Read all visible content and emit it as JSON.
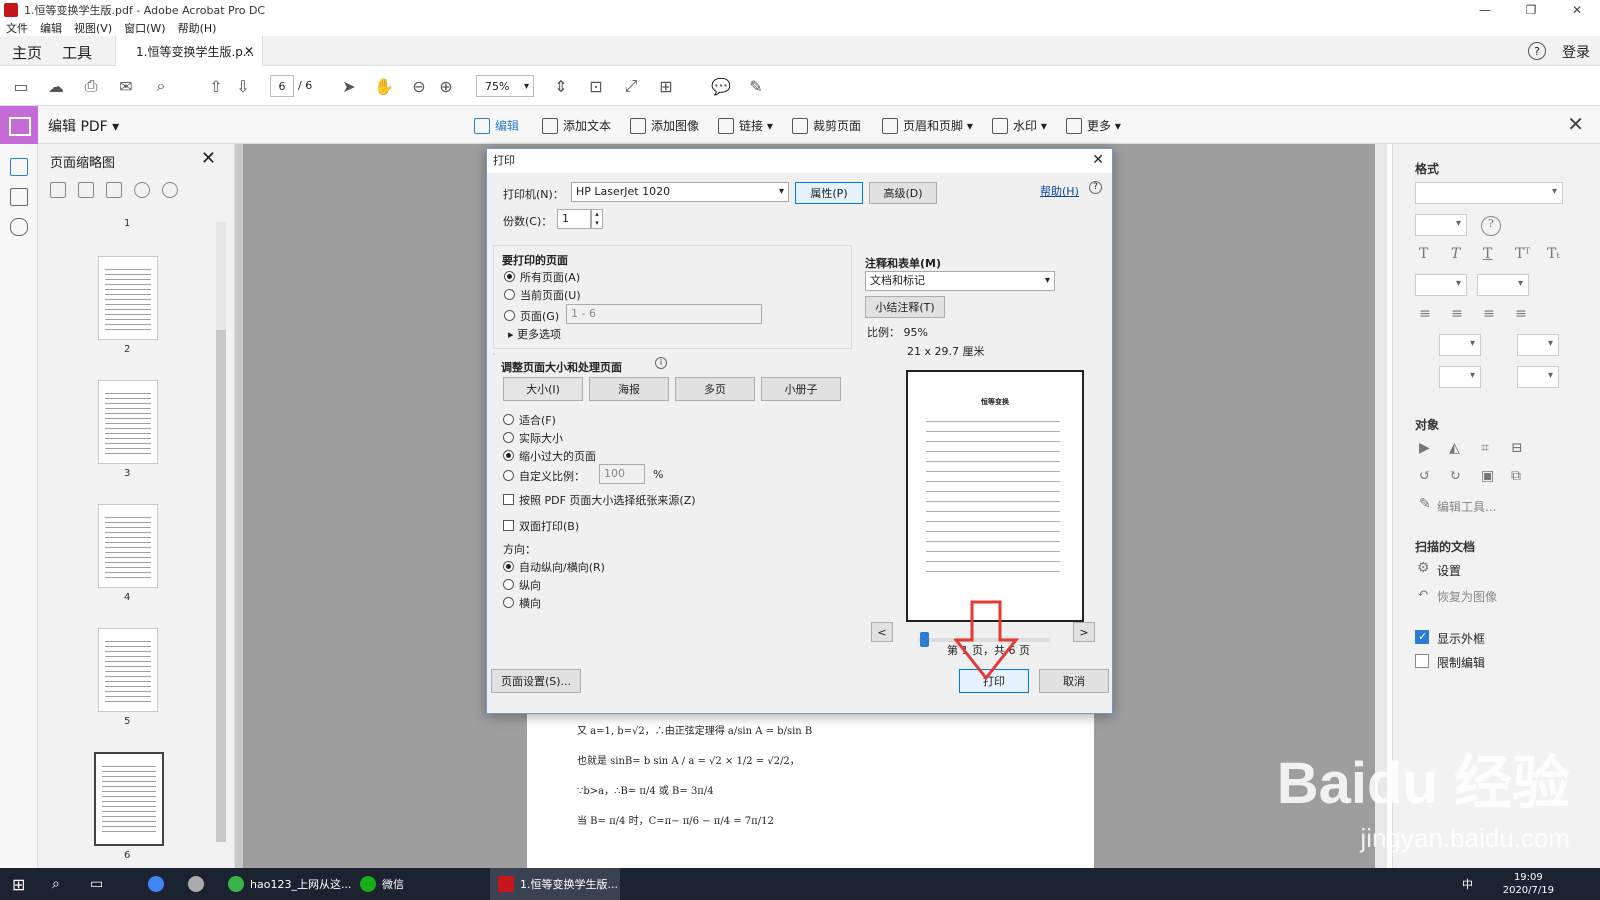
{
  "window": {
    "title": "1.恒等变换学生版.pdf - Adobe Acrobat Pro DC",
    "controls": [
      "—",
      "❐",
      "✕"
    ]
  },
  "menu": [
    "文件",
    "编辑",
    "视图(V)",
    "窗口(W)",
    "帮助(H)"
  ],
  "tabs": {
    "home": "主页",
    "tools": "工具",
    "doc": "1.恒等变换学生版.p...",
    "close": "✕",
    "help": "?",
    "login": "登录"
  },
  "toolbar": {
    "page_current": "6",
    "page_total": "/ 6",
    "zoom": "75%"
  },
  "editbar": {
    "label": "编辑 PDF ▾",
    "tools": [
      "编辑",
      "添加文本",
      "添加图像",
      "链接 ▾",
      "裁剪页面",
      "页眉和页脚 ▾",
      "水印 ▾",
      "更多 ▾"
    ],
    "close": "✕"
  },
  "thumbs": {
    "title": "页面缩略图",
    "close": "✕",
    "pages": [
      "1",
      "2",
      "3",
      "4",
      "5",
      "6"
    ]
  },
  "rightpanel": {
    "format": "格式",
    "object": "对象",
    "edit_tools": "编辑工具...",
    "scanned": "扫描的文档",
    "settings": "设置",
    "restore": "恢复为图像",
    "show_bbox": "显示外框",
    "restrict_edit": "限制编辑"
  },
  "dialog": {
    "title": "打印",
    "close": "✕",
    "printer_label": "打印机(N)：",
    "printer_value": "HP LaserJet 1020",
    "props_btn": "属性(P)",
    "advanced_btn": "高级(D)",
    "help_link": "帮助(H)",
    "copies_label": "份数(C)：",
    "copies_value": "1",
    "pages_group": "要打印的页面",
    "all_pages": "所有页面(A)",
    "current_page": "当前页面(U)",
    "pages": "页面(G)",
    "pages_range": "1 - 6",
    "more_options": "更多选项",
    "sizing_group": "调整页面大小和处理页面",
    "size_btn": "大小(I)",
    "poster_btn": "海报",
    "multiple_btn": "多页",
    "booklet_btn": "小册子",
    "fit": "适合(F)",
    "actual": "实际大小",
    "shrink": "缩小过大的页面",
    "custom_scale": "自定义比例：",
    "scale_value": "100",
    "percent": "%",
    "paper_source": "按照 PDF 页面大小选择纸张来源(Z)",
    "duplex": "双面打印(B)",
    "orientation": "方向：",
    "auto_orient": "自动纵向/横向(R)",
    "portrait": "纵向",
    "landscape": "横向",
    "comments_group": "注释和表单(M)",
    "comments_value": "文档和标记",
    "summarize_btn": "小结注释(T)",
    "scale_text": "比例：  95%",
    "paper_size": "21 x 29.7 厘米",
    "preview_title": "恒等变换",
    "prev": "<",
    "next": ">",
    "page_of": "第 1 页，共 6 页",
    "page_setup_btn": "页面设置(S)...",
    "print_btn": "打印",
    "cancel_btn": "取消"
  },
  "document_lines": [
    "又 a=1, b=√2，∴由正弦定理得 a/sin A = b/sin B",
    "也就是 sinB= b sin A / a = √2 × 1/2 = √2/2，",
    "∵b>a，∴B= π/4 或 B= 3π/4",
    "当 B= π/4 时，C=π− π/6 − π/4 = 7π/12"
  ],
  "watermark": {
    "brand": "Baidu 经验",
    "site": "jingyan.baidu.com"
  },
  "taskbar": {
    "items": [
      "hao123_上网从这...",
      "微信",
      "1.恒等变换学生版..."
    ],
    "time": "19:09",
    "date": "2020/7/19",
    "ime": "中"
  },
  "colors": {
    "accent_blue": "#2b7cd3",
    "edit_purple": "#c56bd6",
    "arrow_red": "#e53935",
    "taskbar": "#1c2330"
  }
}
